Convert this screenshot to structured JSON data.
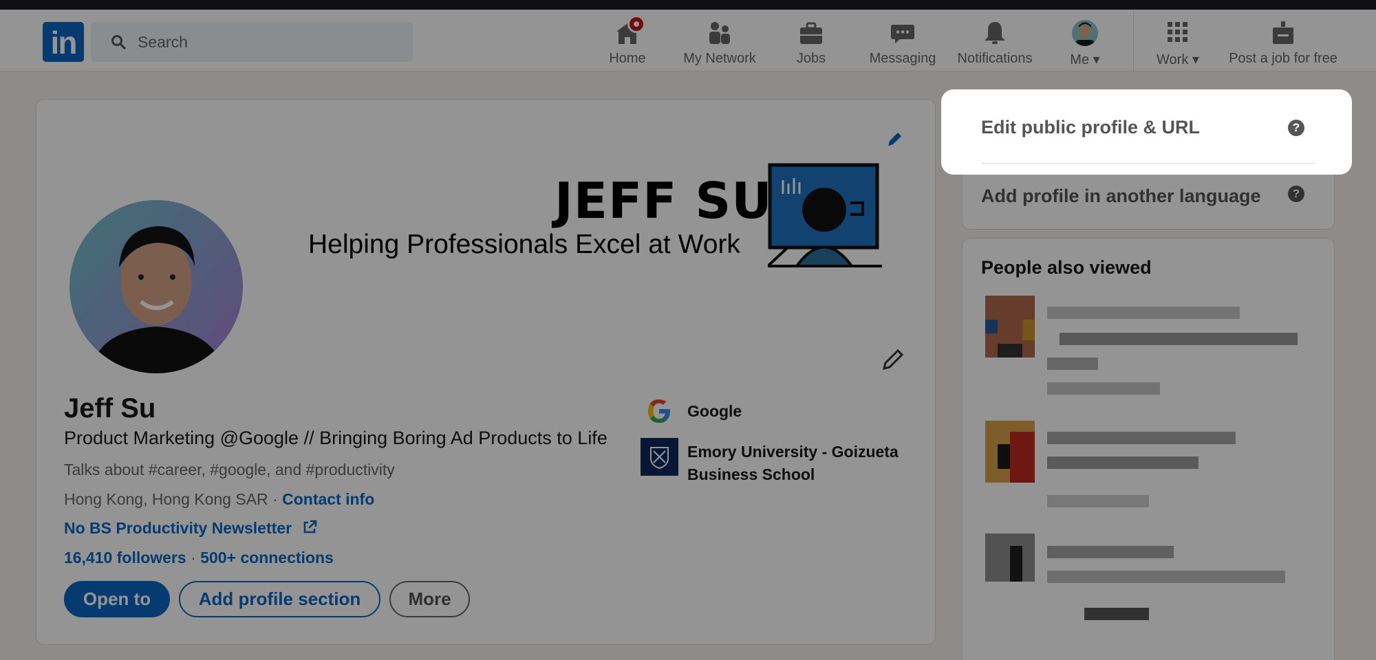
{
  "nav": {
    "search_placeholder": "Search",
    "items": [
      {
        "label": "Home",
        "icon": "home-icon",
        "badge": true
      },
      {
        "label": "My Network",
        "icon": "people-icon"
      },
      {
        "label": "Jobs",
        "icon": "briefcase-icon"
      },
      {
        "label": "Messaging",
        "icon": "chat-icon"
      },
      {
        "label": "Notifications",
        "icon": "bell-icon"
      },
      {
        "label": "Me",
        "icon": "avatar"
      },
      {
        "label": "Work",
        "icon": "grid-icon"
      },
      {
        "label": "Post a job for free",
        "icon": "post-job-icon"
      }
    ]
  },
  "profile": {
    "banner_name": "JEFF SU",
    "banner_tagline": "Helping Professionals Excel at Work",
    "name": "Jeff Su",
    "headline": "Product Marketing @Google // Bringing Boring Ad Products to Life",
    "talks_about": "Talks about #career, #google, and #productivity",
    "location": "Hong Kong, Hong Kong SAR",
    "location_sep": " · ",
    "contact_info": "Contact info",
    "newsletter": "No BS Productivity Newsletter",
    "followers": "16,410 followers",
    "stats_sep": " · ",
    "connections": "500+ connections",
    "buttons": {
      "open_to": "Open to",
      "add_section": "Add profile section",
      "more": "More"
    },
    "orgs": [
      {
        "name": "Google"
      },
      {
        "name": "Emory University - Goizueta Business School"
      }
    ]
  },
  "sidebar": {
    "edit_public": "Edit public profile & URL",
    "add_language": "Add profile in another language",
    "help_glyph": "?",
    "people_title": "People also viewed"
  },
  "colors": {
    "accent": "#0a66c2",
    "badge": "#cc1016",
    "overlay": "rgba(0,0,0,0.42)"
  }
}
